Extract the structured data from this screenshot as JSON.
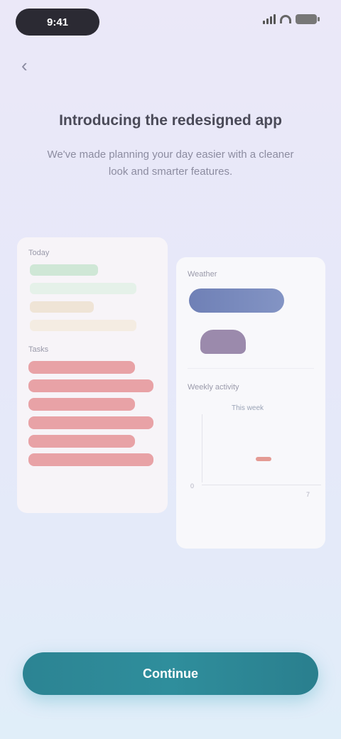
{
  "status_bar": {
    "time": "9:41",
    "signal": "signal-icon",
    "wifi": "wifi-icon",
    "battery": "battery-icon"
  },
  "nav": {
    "back_icon": "chevron-left-icon",
    "back_glyph": "‹"
  },
  "header": {
    "title": "Introducing the redesigned app",
    "subtitle": "We've made planning your day easier with a cleaner look and smarter features."
  },
  "preview_left": {
    "label": "Today",
    "rows": [
      "",
      "",
      "",
      ""
    ],
    "list_label": "Tasks",
    "list_items": [
      "",
      "",
      "",
      "",
      "",
      ""
    ]
  },
  "preview_right": {
    "label": "Weather",
    "chart_title": "Weekly activity",
    "chart_tag": "This week",
    "ticks": [
      "0",
      "7"
    ]
  },
  "cta": {
    "label": "Continue"
  },
  "colors": {
    "accent": "#2c8493",
    "list": "#e8a2a6",
    "background": "#e6e8f9"
  }
}
